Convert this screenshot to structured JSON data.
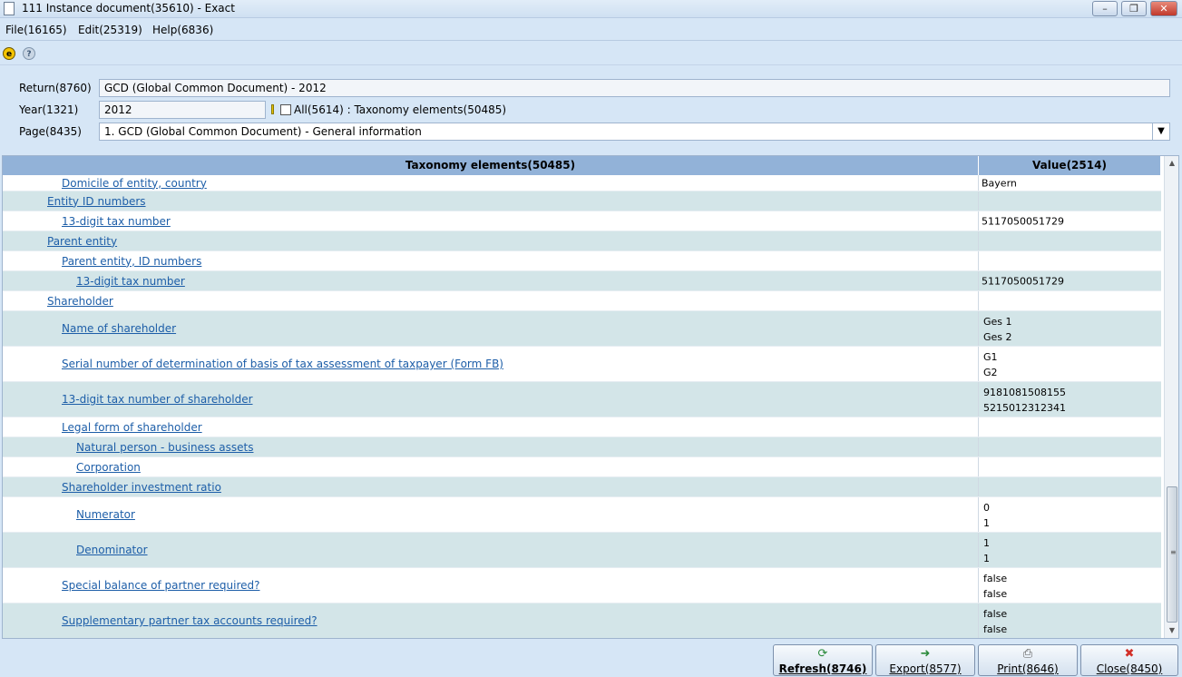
{
  "window": {
    "title": "111 Instance document(35610) - Exact",
    "minimize": "–",
    "maximize": "❐",
    "close": "✕"
  },
  "menu": {
    "file": "File(16165)",
    "edit": "Edit(25319)",
    "help": "Help(6836)"
  },
  "toolbar": {
    "icons": [
      "exact-logo-icon",
      "help-icon"
    ]
  },
  "form": {
    "return_label": "Return(8760)",
    "return_value": "GCD (Global Common Document) - 2012",
    "year_label": "Year(1321)",
    "year_value": "2012",
    "all_label": "All(5614) : Taxonomy elements(50485)",
    "all_checked": false,
    "page_label": "Page(8435)",
    "page_value": "1.  GCD (Global Common Document) - General information"
  },
  "grid": {
    "col_elements": "Taxonomy elements(50485)",
    "col_value": "Value(2514)",
    "rows": [
      {
        "label": "Domicile of entity, country",
        "level": 2,
        "values": [
          "Bayern"
        ]
      },
      {
        "label": "Entity ID numbers",
        "level": 1,
        "values": []
      },
      {
        "label": "13-digit tax number",
        "level": 2,
        "values": [
          "5117050051729"
        ]
      },
      {
        "label": "Parent entity",
        "level": 1,
        "values": []
      },
      {
        "label": "Parent entity, ID numbers",
        "level": 2,
        "values": []
      },
      {
        "label": "13-digit tax number",
        "level": 3,
        "values": [
          "5117050051729"
        ]
      },
      {
        "label": "Shareholder",
        "level": 1,
        "values": []
      },
      {
        "label": "Name of shareholder",
        "level": 2,
        "values": [
          "Ges 1",
          "Ges 2"
        ]
      },
      {
        "label": "Serial number of determination of basis of tax assessment of taxpayer (Form FB)",
        "level": 2,
        "values": [
          "G1",
          "G2"
        ]
      },
      {
        "label": "13-digit tax number of shareholder",
        "level": 2,
        "values": [
          "9181081508155",
          "5215012312341"
        ]
      },
      {
        "label": "Legal form of shareholder",
        "level": 2,
        "values": []
      },
      {
        "label": "Natural person - business assets",
        "level": 3,
        "values": []
      },
      {
        "label": "Corporation",
        "level": 3,
        "values": []
      },
      {
        "label": "Shareholder investment ratio",
        "level": 2,
        "values": []
      },
      {
        "label": "Numerator",
        "level": 3,
        "values": [
          "0",
          "1"
        ]
      },
      {
        "label": "Denominator",
        "level": 3,
        "values": [
          "1",
          "1"
        ]
      },
      {
        "label": "Special balance of partner required?",
        "level": 2,
        "values": [
          "false",
          "false"
        ]
      },
      {
        "label": "Supplementary partner tax accounts required?",
        "level": 2,
        "values": [
          "false",
          "false"
        ]
      }
    ]
  },
  "buttons": {
    "refresh": "Refresh(8746)",
    "export": "Export(8577)",
    "print": "Print(8646)",
    "close": "Close(8450)"
  },
  "colors": {
    "accent": "#92b2d8",
    "link": "#1d5ea8",
    "alt_row": "#d3e5e8",
    "close_icon": "#d22f27"
  }
}
